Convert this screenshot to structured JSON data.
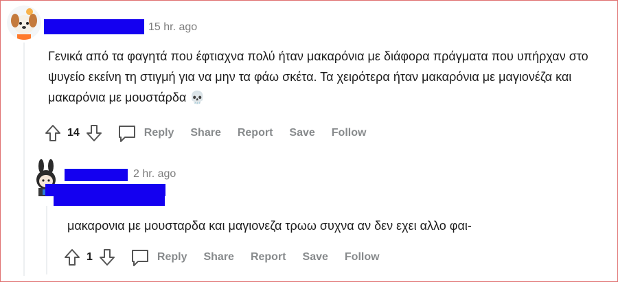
{
  "comment1": {
    "time": "15 hr. ago",
    "text": "Γενικά από τα φαγητά που έφτιαχνα πολύ ήταν μακαρόνια με διάφορα πράγματα που υπήρχαν στο ψυγείο εκείνη τη στιγμή για να μην τα φάω σκέτα. Τα χειρότερα ήταν μακαρόνια με μαγιονέζα και μακαρόνια με μουστάρδα 💀",
    "score": "14",
    "actions": {
      "reply": "Reply",
      "share": "Share",
      "report": "Report",
      "save": "Save",
      "follow": "Follow"
    }
  },
  "comment2": {
    "time": "2 hr. ago",
    "text": "μακαρονια με μουσταρδα και μαγιονεζα τρωω συχνα αν δεν εχει αλλο φαι-",
    "score": "1",
    "actions": {
      "reply": "Reply",
      "share": "Share",
      "report": "Report",
      "save": "Save",
      "follow": "Follow"
    }
  },
  "colors": {
    "redaction": "#1400f0",
    "muted": "#878a8c",
    "border": "#e07070"
  }
}
